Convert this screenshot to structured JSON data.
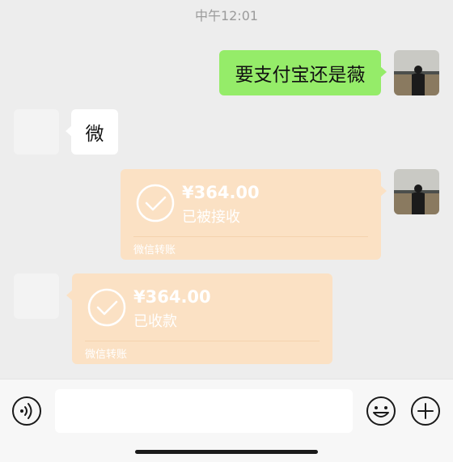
{
  "status": {
    "time": "中午12:01"
  },
  "messages": {
    "msg1": {
      "text": "要支付宝还是薇"
    },
    "msg2": {
      "text": "微"
    },
    "transfer_sent": {
      "amount": "¥364.00",
      "status": "已被接收",
      "label": "微信转账"
    },
    "transfer_received": {
      "amount": "¥364.00",
      "status": "已收款",
      "label": "微信转账"
    }
  },
  "input": {
    "value": "",
    "placeholder": ""
  },
  "icons": {
    "voice": "voice-icon",
    "emoji": "emoji-icon",
    "plus": "plus-icon",
    "check": "check-circle-icon"
  },
  "colors": {
    "background": "#ededed",
    "self_bubble": "#95ec69",
    "peer_bubble": "#ffffff",
    "transfer_card": "#fbe1c4"
  }
}
